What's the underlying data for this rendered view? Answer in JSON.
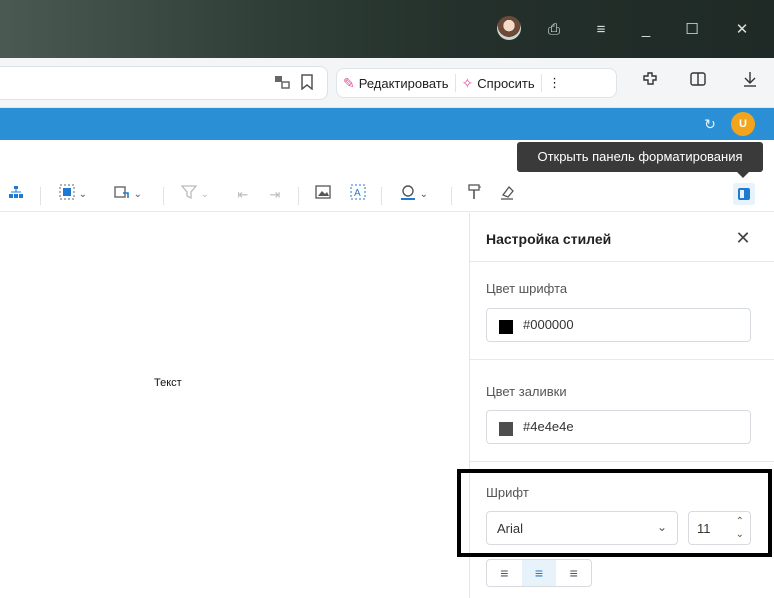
{
  "titlebar": {
    "controls": [
      "⎙",
      "≡",
      "_",
      "☐",
      "✕"
    ]
  },
  "addressbar": {
    "edit_label": "Редактировать",
    "ask_label": "Спросить",
    "more_label": "⋮"
  },
  "tooltip": {
    "text": "Открыть панель форматирования"
  },
  "appbar": {
    "user_initial": "U"
  },
  "canvas": {
    "text": "Текст"
  },
  "panel": {
    "title": "Настройка стилей",
    "font_color_label": "Цвет шрифта",
    "font_color_value": "#000000",
    "fill_color_label": "Цвет заливки",
    "fill_color_value": "#4e4e4e",
    "font_label": "Шрифт",
    "font_family": "Arial",
    "font_size": "11"
  },
  "colors": {
    "accent": "#2b8fd6",
    "font_swatch": "#000000",
    "fill_swatch": "#4e4e4e"
  }
}
